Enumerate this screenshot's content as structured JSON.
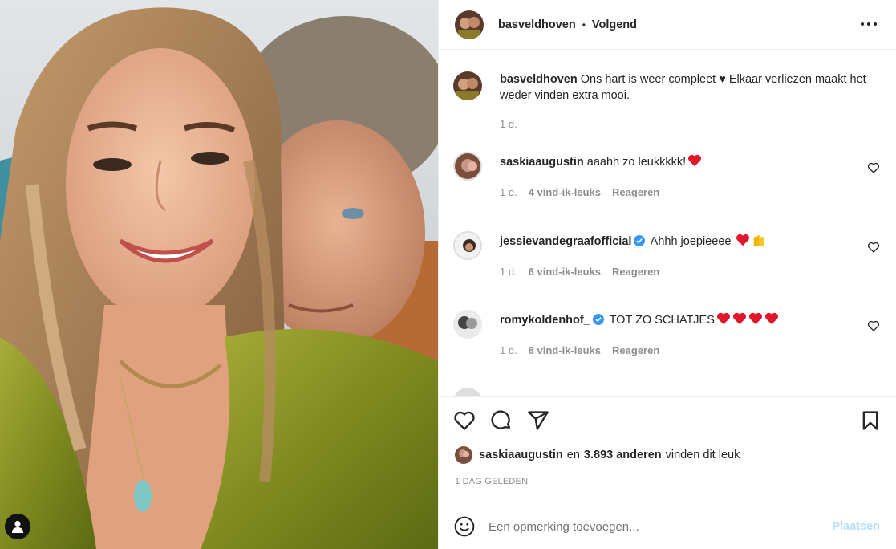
{
  "post": {
    "author": "basveldhoven",
    "separator": "•",
    "follow_label": "Volgend",
    "caption": "Ons hart is weer compleet ♥ Elkaar verliezen maakt het weder vinden extra mooi.",
    "caption_age": "1 d."
  },
  "comments": [
    {
      "user": "saskiaaugustin",
      "verified": false,
      "text": "aaahh zo leukkkkk!",
      "emojis": [
        "red-heart"
      ],
      "age": "1 d.",
      "likes": "4 vind-ik-leuks",
      "reply": "Reageren"
    },
    {
      "user": "jessievandegraafofficial",
      "verified": true,
      "text": "Ahhh joepieeee",
      "emojis": [
        "red-heart",
        "raising-hands"
      ],
      "age": "1 d.",
      "likes": "6 vind-ik-leuks",
      "reply": "Reageren"
    },
    {
      "user": "romykoldenhof_",
      "verified": true,
      "text": "TOT ZO SCHATJES",
      "emojis": [
        "red-heart",
        "red-heart",
        "red-heart",
        "red-heart"
      ],
      "age": "1 d.",
      "likes": "8 vind-ik-leuks",
      "reply": "Reageren"
    }
  ],
  "likes_line": {
    "user": "saskiaaugustin",
    "connector": "en",
    "count": "3.893 anderen",
    "suffix": "vinden dit leuk"
  },
  "timestamp": "1 DAG GELEDEN",
  "composer": {
    "placeholder": "Een opmerking toevoegen...",
    "post_label": "Plaatsen"
  },
  "colors": {
    "verified": "#3897f0",
    "heart": "#ed4956",
    "post_button_disabled": "#b2dffc",
    "secondary_text": "#8e8e8e"
  },
  "icons": [
    "more-icon",
    "heart-icon",
    "comment-icon",
    "share-icon",
    "bookmark-icon",
    "emoji-icon",
    "user-tag-icon",
    "verified-badge-icon"
  ]
}
